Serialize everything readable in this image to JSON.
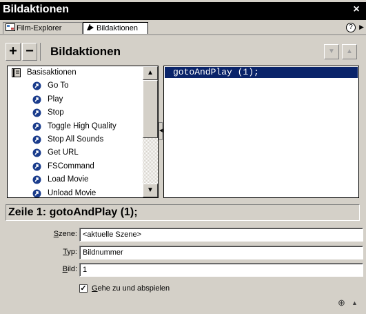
{
  "window": {
    "title": "Bildaktionen",
    "close_glyph": "×"
  },
  "tabs": [
    {
      "label": "Film-Explorer",
      "icon": "film-explorer-icon"
    },
    {
      "label": "Bildaktionen",
      "icon": "actions-icon"
    }
  ],
  "tab_controls": {
    "help_glyph": "?",
    "menu_glyph": "▶"
  },
  "toolbar": {
    "add_label": "+",
    "remove_label": "−",
    "title": "Bildaktionen",
    "down_glyph": "▼",
    "up_glyph": "▲"
  },
  "actions_list": {
    "header": "Basisaktionen",
    "items": [
      "Go To",
      "Play",
      "Stop",
      "Toggle High Quality",
      "Stop All Sounds",
      "Get URL",
      "FSCommand",
      "Load Movie",
      "Unload Movie"
    ]
  },
  "scrollbar": {
    "up_glyph": "▲",
    "down_glyph": "▼"
  },
  "splitter": {
    "glyph": "◀"
  },
  "script": {
    "selected_line": "gotoAndPlay (1);"
  },
  "status": {
    "text": "Zeile 1: gotoAndPlay (1);"
  },
  "form": {
    "szene": {
      "label_ul": "S",
      "label_rest": "zene:",
      "value": "<aktuelle Szene>"
    },
    "typ": {
      "label_ul": "T",
      "label_rest": "yp:",
      "value": "Bildnummer"
    },
    "bild": {
      "label_ul": "B",
      "label_rest": "ild:",
      "value": "1"
    },
    "play_checkbox": {
      "checked_glyph": "✓",
      "label_ul": "G",
      "label_rest": "ehe zu und abspielen"
    }
  },
  "footer": {
    "target_glyph": "⊕",
    "collapse_glyph": "▲"
  }
}
